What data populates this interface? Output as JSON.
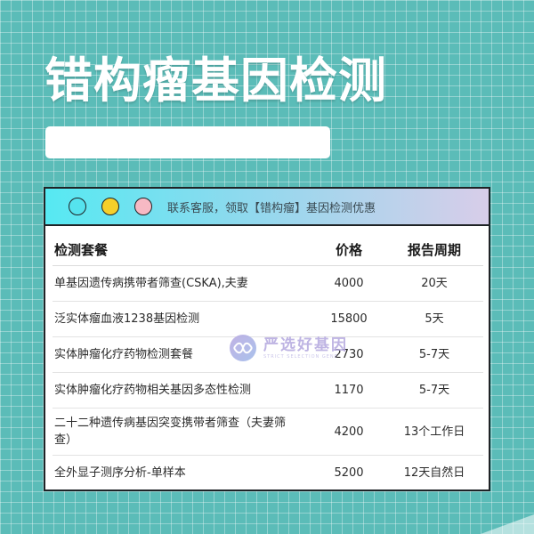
{
  "page": {
    "title": "错构瘤基因检测"
  },
  "card": {
    "header_text": "联系客服，领取【错构瘤】基因检测优惠",
    "dots": [
      {
        "name": "cyan-dot",
        "color": "#55e3ee"
      },
      {
        "name": "yellow-dot",
        "color": "#f5cf2a"
      },
      {
        "name": "pink-dot",
        "color": "#f7b9c4"
      }
    ]
  },
  "table": {
    "headers": [
      "检测套餐",
      "价格",
      "报告周期"
    ],
    "rows": [
      {
        "name": "单基因遗传病携带者筛查(CSKA),夫妻",
        "price": "4000",
        "period": "20天"
      },
      {
        "name": "泛实体瘤血液1238基因检测",
        "price": "15800",
        "period": "5天"
      },
      {
        "name": "实体肿瘤化疗药物检测套餐",
        "price": "2730",
        "period": "5-7天"
      },
      {
        "name": "实体肿瘤化疗药物相关基因多态性检测",
        "price": "1170",
        "period": "5-7天"
      },
      {
        "name": "二十二种遗传病基因突变携带者筛查（夫妻筛查）",
        "price": "4200",
        "period": "13个工作日"
      },
      {
        "name": "全外显子测序分析-单样本",
        "price": "5200",
        "period": "12天自然日"
      }
    ]
  },
  "watermark": {
    "text": "严选好基因",
    "sub": "STRICT SELECTION GENE"
  },
  "colors": {
    "background": "#5bbcb8",
    "accent": "#56e9f2"
  }
}
